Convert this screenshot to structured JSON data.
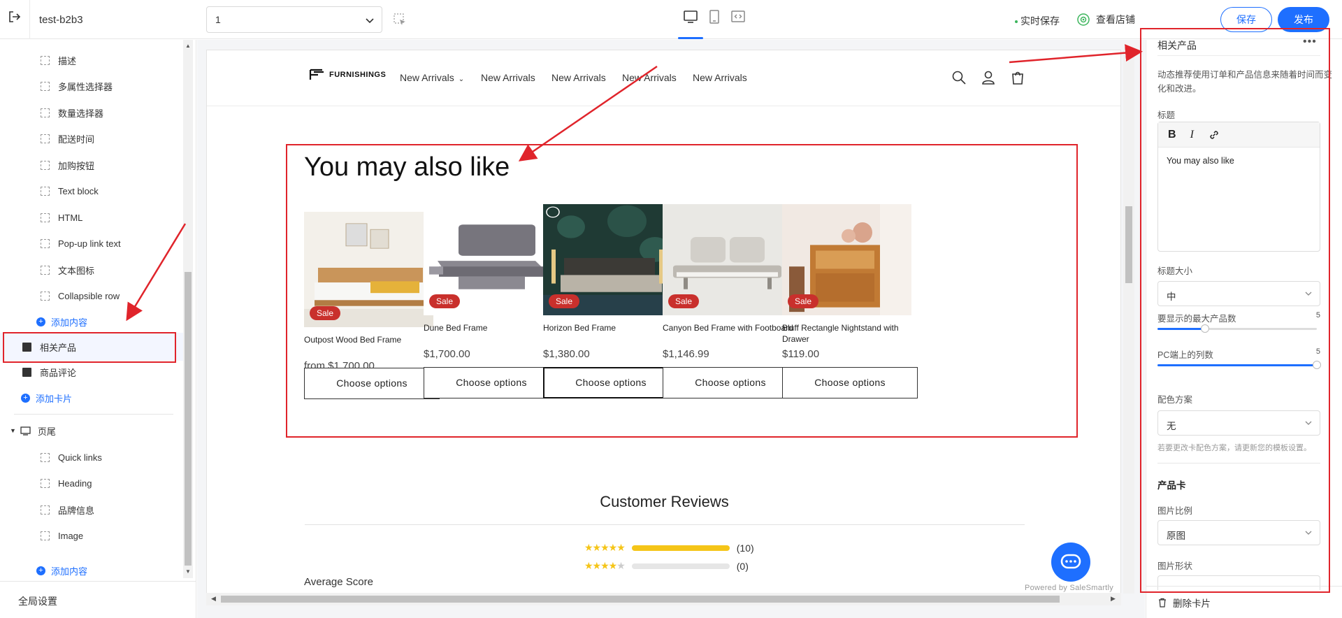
{
  "topbar": {
    "store_name": "test-b2b3",
    "page_select_value": "1",
    "autosave_label": "实时保存",
    "view_store_label": "查看店铺",
    "save_label": "保存",
    "publish_label": "发布"
  },
  "sidebar": {
    "block_items": [
      "描述",
      "多属性选择器",
      "数量选择器",
      "配送时间",
      "加购按钮",
      "Text block",
      "HTML",
      "Pop-up link text",
      "文本图标",
      "Collapsible row"
    ],
    "add_content_label": "添加内容",
    "section_related": "相关产品",
    "section_reviews": "商品评论",
    "add_card_label": "添加卡片",
    "footer_group": "页尾",
    "footer_items": [
      "Quick links",
      "Heading",
      "品牌信息",
      "Image"
    ],
    "footer_add_content_label": "添加内容",
    "global_settings_label": "全局设置"
  },
  "store": {
    "logo_text": "FURNISHINGS",
    "nav": [
      "New Arrivals",
      "New Arrivals",
      "New Arrivals",
      "New Arrivals",
      "New Arrivals"
    ],
    "related_title": "You may also like",
    "sale_badge": "Sale",
    "choose_label": "Choose options",
    "products": [
      {
        "name": "Outpost Wood Bed Frame",
        "price": "from $1,700.00"
      },
      {
        "name": "Dune Bed Frame",
        "price": "$1,700.00"
      },
      {
        "name": "Horizon Bed Frame",
        "price": "$1,380.00"
      },
      {
        "name": "Canyon Bed Frame with Footboard",
        "price": "$1,146.99"
      },
      {
        "name": "Bluff Rectangle Nightstand with Drawer",
        "price": "$119.00"
      }
    ],
    "reviews_title": "Customer Reviews",
    "average_score_label": "Average Score",
    "rating_rows": [
      {
        "stars": 5,
        "count": "(10)",
        "fill": 1.0
      },
      {
        "stars": 4,
        "count": "(0)",
        "fill": 0.0
      }
    ],
    "powered_by": "Powered by SaleSmartly"
  },
  "panel": {
    "title": "相关产品",
    "description": "动态推荐使用订单和产品信息来随着时间而变化和改进。",
    "heading_label": "标题",
    "heading_value": "You may also like",
    "heading_size_label": "标题大小",
    "heading_size_value": "中",
    "max_products_label": "要显示的最大产品数",
    "max_products_value": "5",
    "max_products_fraction": 0.3,
    "pc_columns_label": "PC端上的列数",
    "pc_columns_value": "5",
    "pc_columns_fraction": 1.0,
    "color_scheme_label": "配色方案",
    "color_scheme_value": "无",
    "color_scheme_hint": "若要更改卡配色方案，请更新您的模板设置。",
    "product_card_label": "产品卡",
    "image_ratio_label": "图片比例",
    "image_ratio_value": "原图",
    "image_shape_label": "图片形状",
    "delete_card_label": "删除卡片"
  },
  "colors": {
    "accent": "#1e6fff",
    "sale": "#c9302c",
    "annotation": "#e0242b",
    "star": "#f5c518"
  }
}
